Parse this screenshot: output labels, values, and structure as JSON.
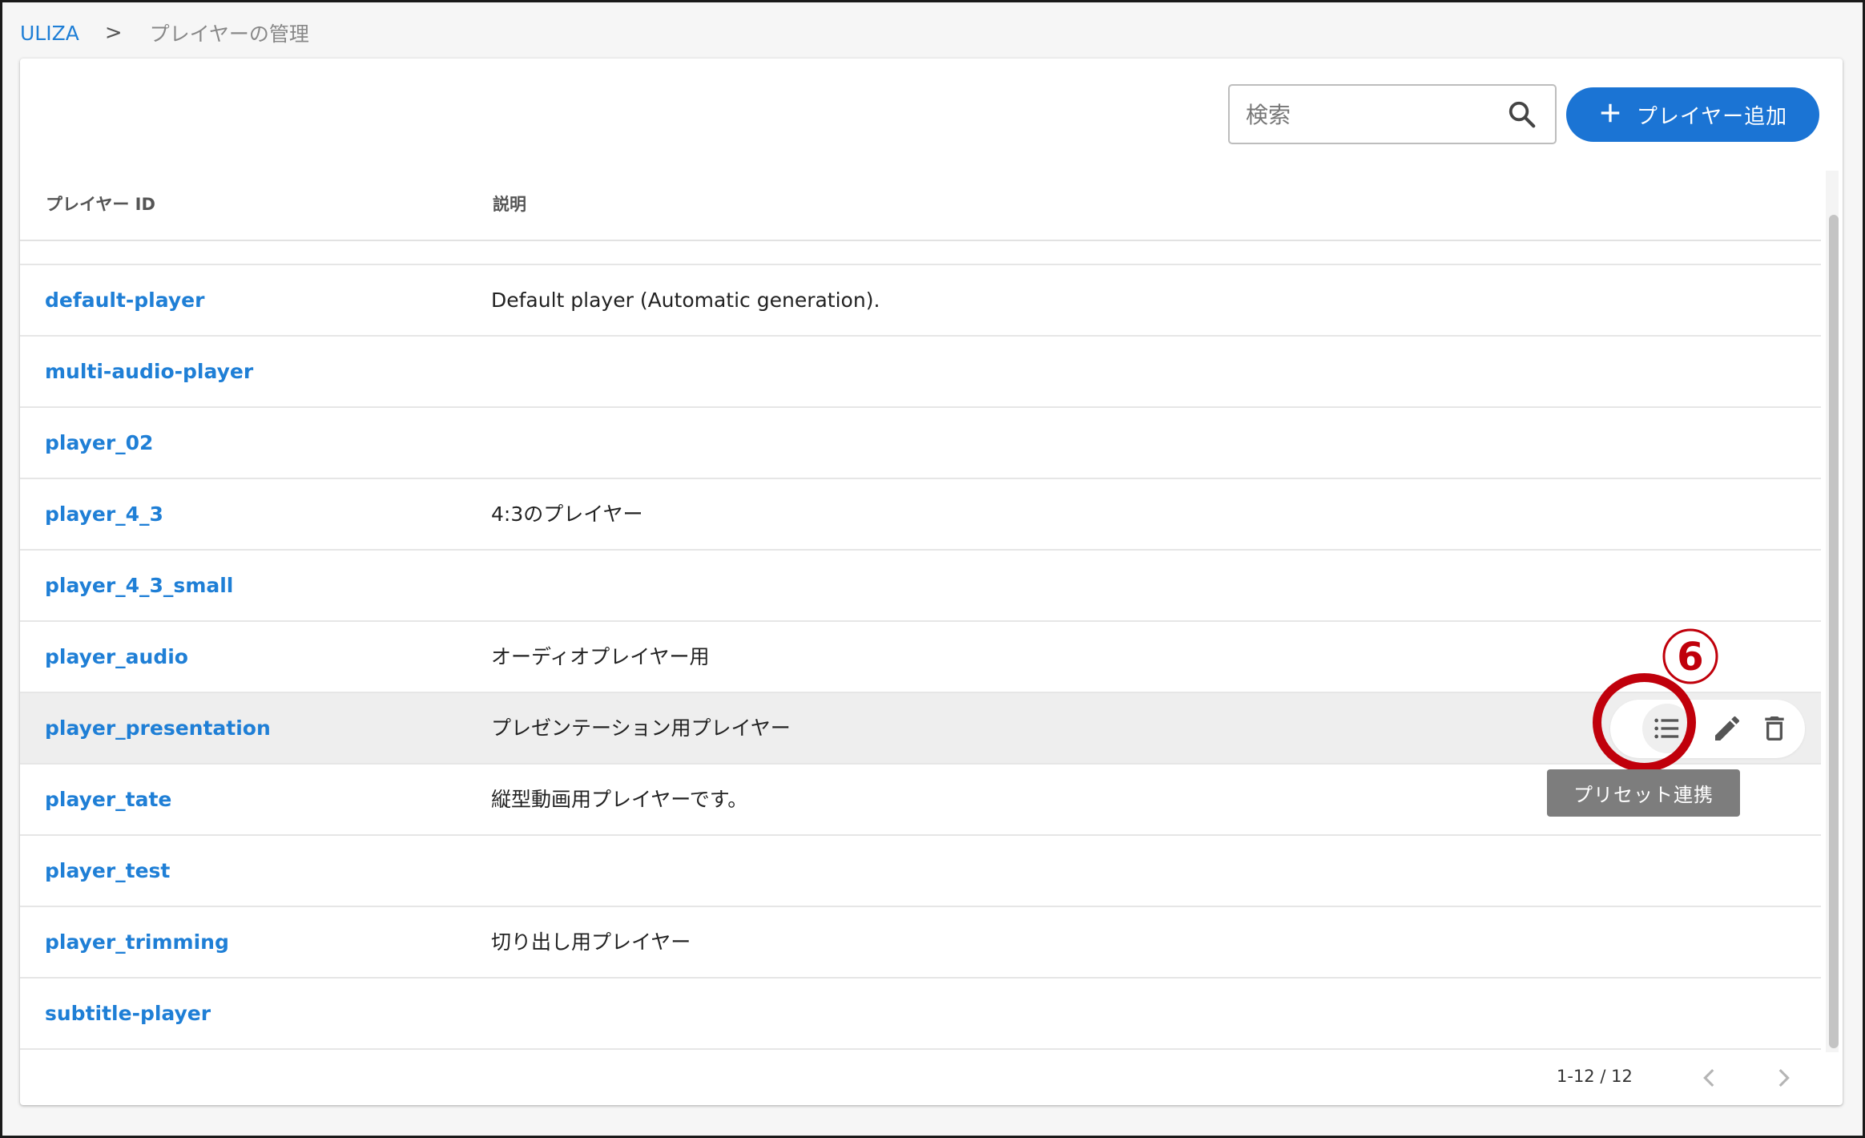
{
  "breadcrumb": {
    "root": "ULIZA",
    "separator": ">",
    "current": "プレイヤーの管理"
  },
  "search": {
    "placeholder": "検索",
    "value": ""
  },
  "toolbar": {
    "add_label": "プレイヤー追加",
    "add_icon": "plus-icon"
  },
  "table": {
    "headers": {
      "id": "プレイヤー ID",
      "description": "説明"
    },
    "rows": [
      {
        "id": "default-player",
        "description": "Default player (Automatic generation)."
      },
      {
        "id": "multi-audio-player",
        "description": ""
      },
      {
        "id": "player_02",
        "description": ""
      },
      {
        "id": "player_4_3",
        "description": "4:3のプレイヤー"
      },
      {
        "id": "player_4_3_small",
        "description": ""
      },
      {
        "id": "player_audio",
        "description": "オーディオプレイヤー用"
      },
      {
        "id": "player_presentation",
        "description": "プレゼンテーション用プレイヤー"
      },
      {
        "id": "player_tate",
        "description": "縦型動画用プレイヤーです。"
      },
      {
        "id": "player_test",
        "description": ""
      },
      {
        "id": "player_trimming",
        "description": "切り出し用プレイヤー"
      },
      {
        "id": "subtitle-player",
        "description": ""
      }
    ],
    "hovered_row": 6
  },
  "row_actions": {
    "icons": [
      "list-icon",
      "pencil-icon",
      "trash-icon"
    ],
    "tooltip": "プリセット連携"
  },
  "annotation": {
    "number": "⑥",
    "color": "#c0000b"
  },
  "pagination": {
    "info": "1-12 / 12"
  },
  "colors": {
    "accent": "#1b74d4",
    "link": "#1f7fd6",
    "annotation": "#c0000b"
  }
}
